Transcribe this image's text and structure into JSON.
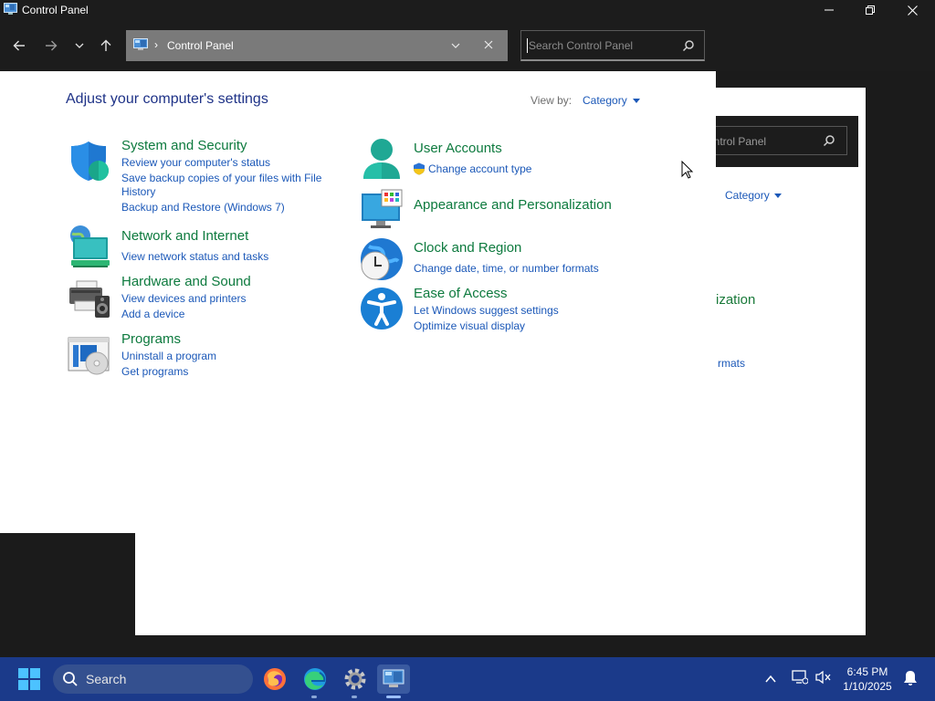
{
  "window": {
    "title": "Control Panel",
    "controls": {
      "minimize": "—",
      "maximize": "☐",
      "close": "✕"
    }
  },
  "nav": {
    "back_icon": "arrow-left-icon",
    "forward_icon": "arrow-right-icon",
    "recent_icon": "chevron-down-icon",
    "up_icon": "arrow-up-icon"
  },
  "address": {
    "separator": "›",
    "path": "Control Panel"
  },
  "search": {
    "placeholder": "Search Control Panel"
  },
  "main": {
    "heading": "Adjust your computer's settings",
    "view_by_label": "View by:",
    "view_by_value": "Category",
    "categories_left": [
      {
        "title": "System and Security",
        "icon": "shield-icon",
        "links": [
          "Review your computer's status",
          "Save backup copies of your files with File",
          "History",
          "Backup and Restore (Windows 7)"
        ]
      },
      {
        "title": "Network and Internet",
        "icon": "globe-network-icon",
        "links": [
          "View network status and tasks"
        ]
      },
      {
        "title": "Hardware and Sound",
        "icon": "printer-speaker-icon",
        "links": [
          "View devices and printers",
          "Add a device"
        ]
      },
      {
        "title": "Programs",
        "icon": "programs-icon",
        "links": [
          "Uninstall a program",
          "Get programs"
        ]
      }
    ],
    "categories_right": [
      {
        "title": "User Accounts",
        "icon": "user-icon",
        "links": [
          "Change account type"
        ]
      },
      {
        "title": "Appearance and Personalization",
        "icon": "monitor-palette-icon",
        "links": []
      },
      {
        "title": "Clock and Region",
        "icon": "clock-globe-icon",
        "links": [
          "Change date, time, or number formats"
        ]
      },
      {
        "title": "Ease of Access",
        "icon": "accessibility-icon",
        "links": [
          "Let Windows suggest settings",
          "Optimize visual display"
        ]
      }
    ]
  },
  "background_window": {
    "search_fragment": "ontrol Panel",
    "view_by_value": "Category",
    "title_fragment": "ization",
    "link_fragment": "rmats"
  },
  "taskbar": {
    "search_label": "Search",
    "time": "6:45 PM",
    "date": "1/10/2025",
    "apps": [
      "firefox-icon",
      "edge-icon",
      "settings-icon",
      "control-panel-icon"
    ]
  },
  "colors": {
    "accent_link": "#1b58b8",
    "category_title": "#0d7a3e",
    "heading": "#1e3287",
    "taskbar": "#1b3a8a"
  }
}
